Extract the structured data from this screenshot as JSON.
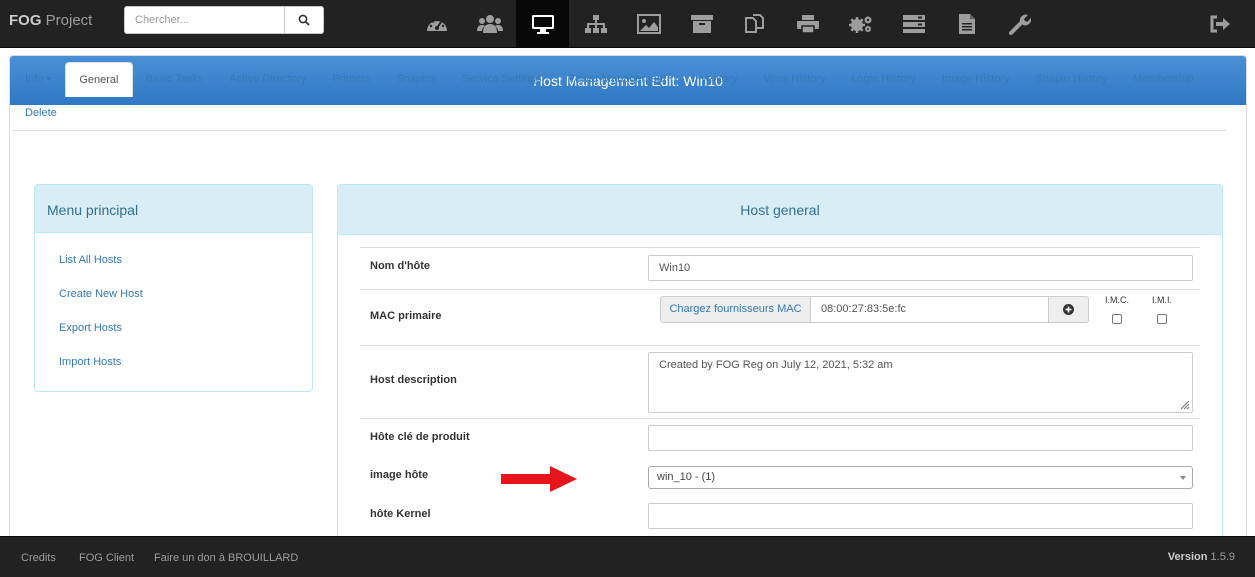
{
  "brand": {
    "bold": "FOG",
    "rest": " Project"
  },
  "search": {
    "placeholder": "Chercher...",
    "icon": "search-icon"
  },
  "nav": {
    "icons": [
      "dashboard-icon",
      "users-icon",
      "hosts-icon",
      "groups-icon",
      "images-icon",
      "storage-icon",
      "snapins-icon",
      "printers-icon",
      "settings-icon",
      "tasks-icon",
      "reports-icon",
      "plugins-icon"
    ],
    "active_index": 2,
    "logout_icon": "logout-icon"
  },
  "panel": {
    "title": "Host Management Edit: Win10"
  },
  "tabs": {
    "row1": [
      "Info",
      "General",
      "Basic Tasks",
      "Active Directory",
      "Printers",
      "Snapins",
      "Service Settings",
      "Power Management",
      "Inventory",
      "Virus History",
      "Login History",
      "Image History",
      "Snapin History",
      "Membership"
    ],
    "row2": [
      "Delete"
    ],
    "active": "General"
  },
  "menu": {
    "title": "Menu principal",
    "items": [
      "List All Hosts",
      "Create New Host",
      "Export Hosts",
      "Import Hosts"
    ]
  },
  "host_general": {
    "title": "Host general",
    "hostname_label": "Nom d'hôte",
    "hostname_value": "Win10",
    "mac_label": "MAC primaire",
    "mac_vendor_button": "Chargez fournisseurs MAC",
    "mac_value": "08:00:27:83:5e:fc",
    "imc_label": "I.M.C.",
    "imi_label": "I.M.I.",
    "description_label": "Host description",
    "description_value": "Created by FOG Reg on July 12, 2021, 5:32 am",
    "product_key_label": "Hôte clé de produit",
    "product_key_value": "",
    "image_label": "image hôte",
    "image_value": "win_10 - (1)",
    "kernel_label": "hôte Kernel",
    "kernel_value": ""
  },
  "footer": {
    "links": [
      "Credits",
      "FOG Client",
      "Faire un don à BROUILLARD"
    ],
    "version_label": "Version",
    "version_value": " 1.5.9"
  }
}
